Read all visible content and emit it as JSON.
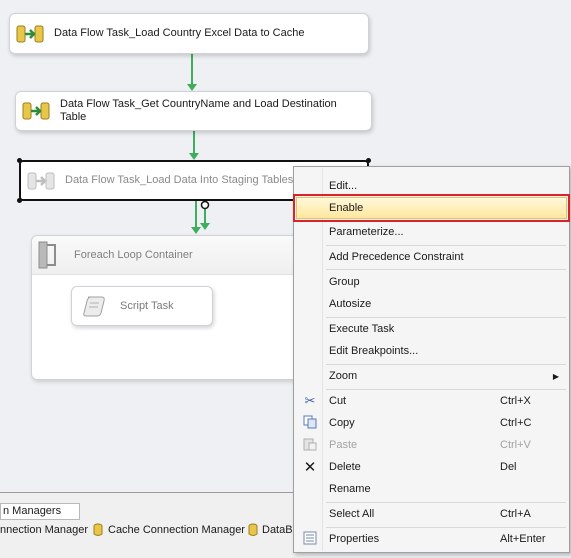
{
  "tasks": {
    "task1": "Data Flow Task_Load Country Excel Data to Cache",
    "task2": "Data Flow Task_Get CountryName and Load Destination Table",
    "task3": "Data Flow Task_Load Data Into Staging Tables"
  },
  "container": {
    "title": "Foreach Loop Container",
    "script_task": "Script Task"
  },
  "context_menu": {
    "edit": "Edit...",
    "enable": "Enable",
    "parameterize": "Parameterize...",
    "add_precedence": "Add Precedence Constraint",
    "group": "Group",
    "autosize": "Autosize",
    "execute_task": "Execute Task",
    "edit_breakpoints": "Edit Breakpoints...",
    "zoom": "Zoom",
    "cut": "Cut",
    "cut_sc": "Ctrl+X",
    "copy": "Copy",
    "copy_sc": "Ctrl+C",
    "paste": "Paste",
    "paste_sc": "Ctrl+V",
    "delete": "Delete",
    "delete_sc": "Del",
    "rename": "Rename",
    "select_all": "Select All",
    "select_all_sc": "Ctrl+A",
    "properties": "Properties",
    "properties_sc": "Alt+Enter"
  },
  "connection_managers": {
    "tab": "n Managers",
    "items": [
      "nnection Manager",
      "Cache Connection Manager",
      "DataBa"
    ]
  },
  "colors": {
    "arrow": "#3fae5c",
    "highlight_box": "#d8232a"
  }
}
